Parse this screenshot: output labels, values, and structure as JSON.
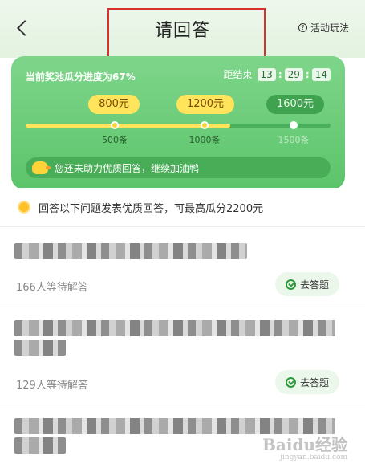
{
  "header": {
    "title": "请回答",
    "rules_label": "活动玩法",
    "rules_icon": "?"
  },
  "card": {
    "progress_text": "当前奖池瓜分进度为67%",
    "progress_fraction": 0.67,
    "countdown_label": "距结束",
    "countdown": [
      "13",
      "29",
      "14"
    ],
    "milestones": [
      {
        "reward": "800元",
        "threshold": "500条",
        "reached": true
      },
      {
        "reward": "1200元",
        "threshold": "1000条",
        "reached": true
      },
      {
        "reward": "1600元",
        "threshold": "1500条",
        "reached": false
      }
    ],
    "encourage_text": "您还未助力优质回答，继续加油鸭"
  },
  "notice": {
    "text": "回答以下问题发表优质回答，可最高瓜分2200元"
  },
  "questions": [
    {
      "waiting": "166人等待解答",
      "button": "去答题"
    },
    {
      "waiting": "129人等待解答",
      "button": "去答题"
    }
  ],
  "watermark": {
    "brand": "Baidu经验",
    "sub": "jingyan.baidu.com"
  },
  "colors": {
    "accent_green": "#5cc46b",
    "highlight_yellow": "#ffe45c",
    "annotation_red": "#d9302c"
  }
}
